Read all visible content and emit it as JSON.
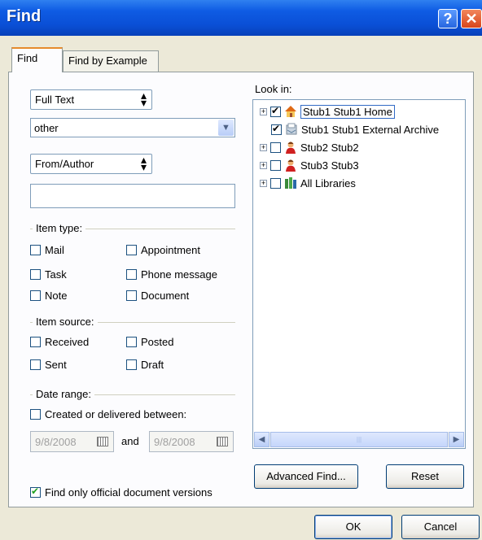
{
  "window": {
    "title": "Find",
    "help": "?",
    "close": "✕"
  },
  "tabs": [
    {
      "label": "Find",
      "active": true
    },
    {
      "label": "Find by Example",
      "active": false
    }
  ],
  "search_field_select": {
    "value": "Full Text"
  },
  "search_text_combo": {
    "value": "other"
  },
  "person_field_select": {
    "value": "From/Author"
  },
  "person_text": {
    "value": ""
  },
  "item_type": {
    "label": "Item type:",
    "options": [
      {
        "label": "Mail",
        "checked": false
      },
      {
        "label": "Appointment",
        "checked": false
      },
      {
        "label": "Task",
        "checked": false
      },
      {
        "label": "Phone message",
        "checked": false
      },
      {
        "label": "Note",
        "checked": false
      },
      {
        "label": "Document",
        "checked": false
      }
    ]
  },
  "item_source": {
    "label": "Item source:",
    "options": [
      {
        "label": "Received",
        "checked": false
      },
      {
        "label": "Posted",
        "checked": false
      },
      {
        "label": "Sent",
        "checked": false
      },
      {
        "label": "Draft",
        "checked": false
      }
    ]
  },
  "date_range": {
    "label": "Date range:",
    "created_between": {
      "label": "Created or delivered between:",
      "checked": false
    },
    "start_date": "9/8/2008",
    "and_label": "and",
    "end_date": "9/8/2008"
  },
  "official_versions": {
    "label": "Find only official document versions",
    "checked": true
  },
  "look_in": {
    "label": "Look in:",
    "items": [
      {
        "label": "Stub1 Stub1 Home",
        "checked": true,
        "expandable": true,
        "icon": "home-icon",
        "selected": true
      },
      {
        "label": "Stub1 Stub1 External Archive",
        "checked": true,
        "expandable": false,
        "icon": "archive-icon",
        "selected": false
      },
      {
        "label": "Stub2 Stub2",
        "checked": false,
        "expandable": true,
        "icon": "user-icon",
        "selected": false
      },
      {
        "label": "Stub3 Stub3",
        "checked": false,
        "expandable": true,
        "icon": "user-icon",
        "selected": false
      },
      {
        "label": "All Libraries",
        "checked": false,
        "expandable": true,
        "icon": "library-icon",
        "selected": false
      }
    ]
  },
  "buttons": {
    "advanced_find": "Advanced Find...",
    "reset": "Reset",
    "ok": "OK",
    "cancel": "Cancel"
  }
}
